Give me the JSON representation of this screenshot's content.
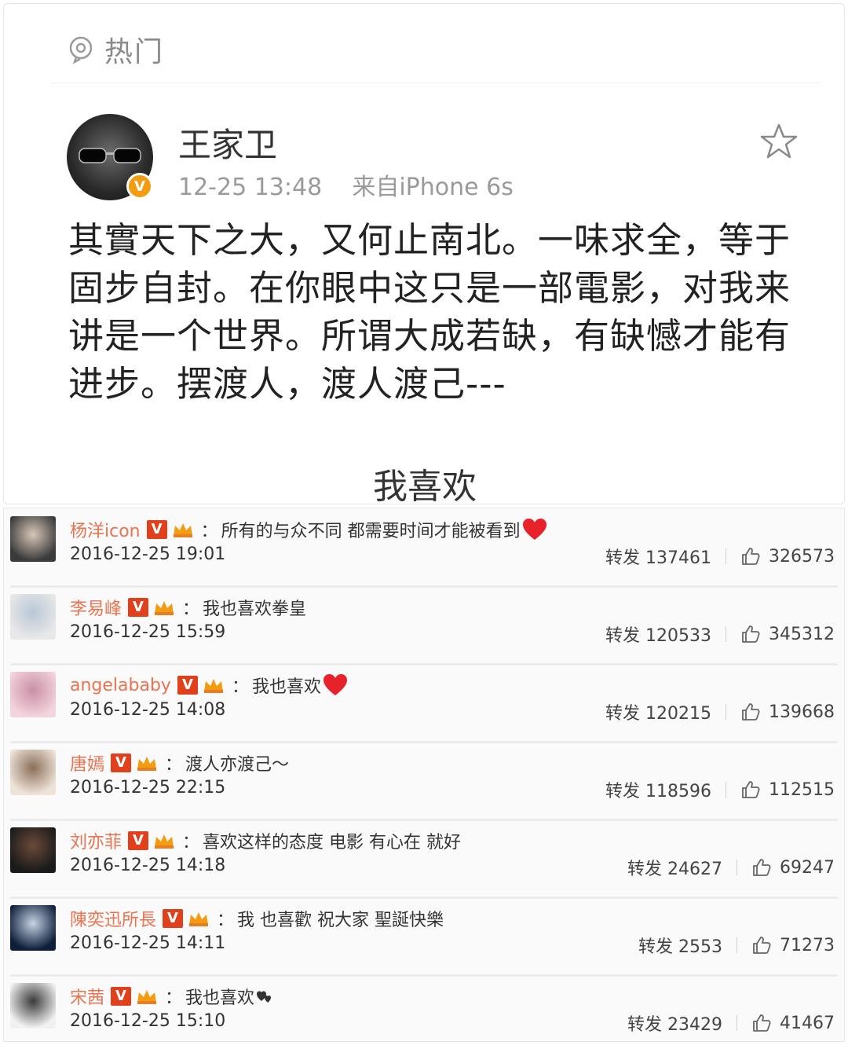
{
  "header": {
    "hot_label": "热门"
  },
  "post": {
    "author": "王家卫",
    "time": "12-25 13:48",
    "source": "来自iPhone 6s",
    "verified_mark": "V",
    "body": "其實天下之大，又何止南北。一味求全，等于固步自封。在你眼中这只是一部電影，对我来讲是一个世界。所谓大成若缺，有缺憾才能有进步。摆渡人，渡人渡己---",
    "like_label": "我喜欢"
  },
  "comments": [
    {
      "name": "杨洋icon",
      "text": "所有的与众不同 都需要时间才能被看到",
      "emoji": "heart",
      "date": "2016-12-25 19:01",
      "reposts": "转发 137461",
      "likes": "326573"
    },
    {
      "name": "李易峰",
      "text": "我也喜欢拳皇",
      "emoji": "",
      "date": "2016-12-25 15:59",
      "reposts": "转发 120533",
      "likes": "345312"
    },
    {
      "name": "angelababy",
      "text": "我也喜欢",
      "emoji": "heart",
      "date": "2016-12-25 14:08",
      "reposts": "转发 120215",
      "likes": "139668"
    },
    {
      "name": "唐嫣",
      "text": "渡人亦渡己～",
      "emoji": "",
      "date": "2016-12-25 22:15",
      "reposts": "转发 118596",
      "likes": "112515"
    },
    {
      "name": "刘亦菲",
      "text": "喜欢这样的态度 电影 有心在 就好",
      "emoji": "",
      "date": "2016-12-25 14:18",
      "reposts": "转发 24627",
      "likes": "69247"
    },
    {
      "name": "陳奕迅所長",
      "text": "我  也喜歡 祝大家 聖誕快樂",
      "emoji": "",
      "date": "2016-12-25 14:11",
      "reposts": "转发 2553",
      "likes": "71273"
    },
    {
      "name": "宋茜",
      "text": "我也喜欢",
      "emoji": "small-hearts",
      "date": "2016-12-25 15:10",
      "reposts": "转发 23429",
      "likes": "41467"
    }
  ],
  "badges": {
    "verified": "V",
    "colon": "："
  },
  "colors": {
    "accent_name": "#eb7350",
    "badge_red": "#e0401c",
    "badge_orange": "#f39c12",
    "heart": "#e8222b"
  }
}
